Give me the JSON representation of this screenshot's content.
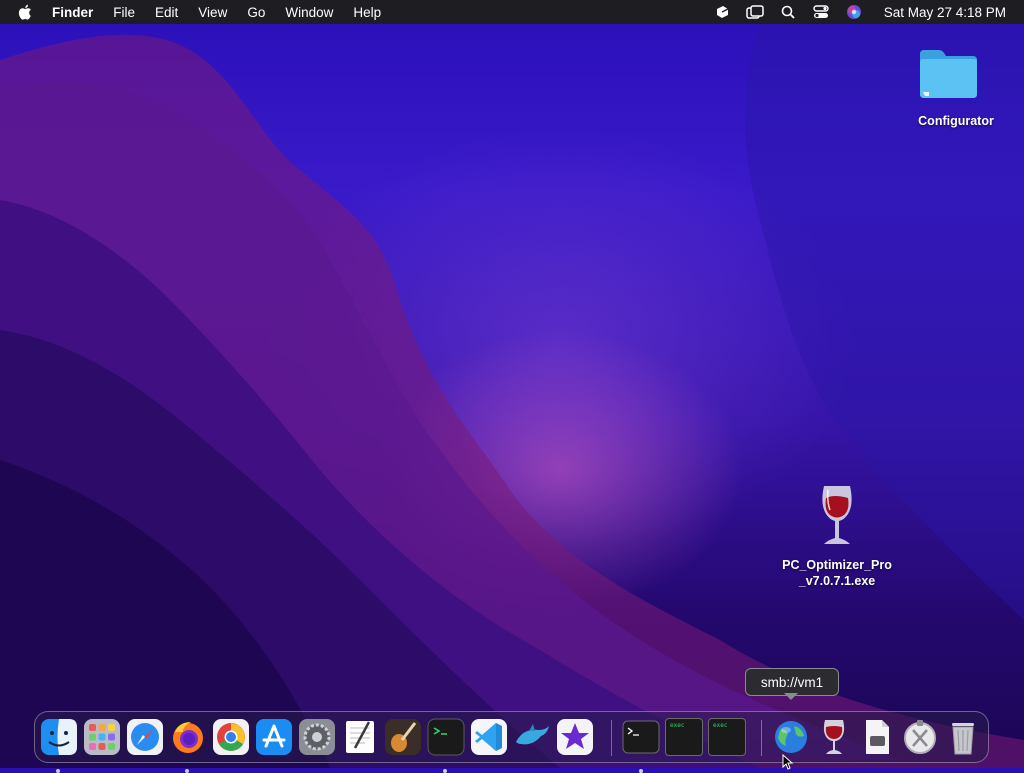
{
  "menubar": {
    "app_name": "Finder",
    "menus": [
      "File",
      "Edit",
      "View",
      "Go",
      "Window",
      "Help"
    ],
    "status_icons": [
      "app-switch-icon",
      "screen-mirroring-icon",
      "search-icon",
      "control-center-icon",
      "siri-icon"
    ],
    "clock": "Sat May 27  4:18 PM"
  },
  "desktop": {
    "folder_label": "Configurator",
    "exe_label_line1": "PC_Optimizer_Pro",
    "exe_label_line2": "_v7.0.7.1.exe"
  },
  "tooltip": {
    "text": "smb://vm1"
  },
  "dock": {
    "apps": [
      "finder-icon",
      "launchpad-icon",
      "safari-icon",
      "firefox-icon",
      "chrome-icon",
      "app-store-icon",
      "system-preferences-icon",
      "textedit-icon",
      "instruments-icon",
      "terminal-icon",
      "vscode-icon",
      "dolphin-icon",
      "imovie-icon"
    ],
    "running": [
      "finder-icon",
      "firefox-icon",
      "terminal-icon"
    ],
    "minimized": [
      "terminal-window-icon",
      "exec-window-icon",
      "exec-window-icon"
    ],
    "right": [
      "network-globe-icon",
      "wine-icon",
      "disk-image-icon",
      "script-editor-icon",
      "trash-icon"
    ],
    "exec_label": "exec"
  },
  "colors": {
    "menubar": "#1d1d22",
    "accent_folder": "#4fb3f0"
  }
}
